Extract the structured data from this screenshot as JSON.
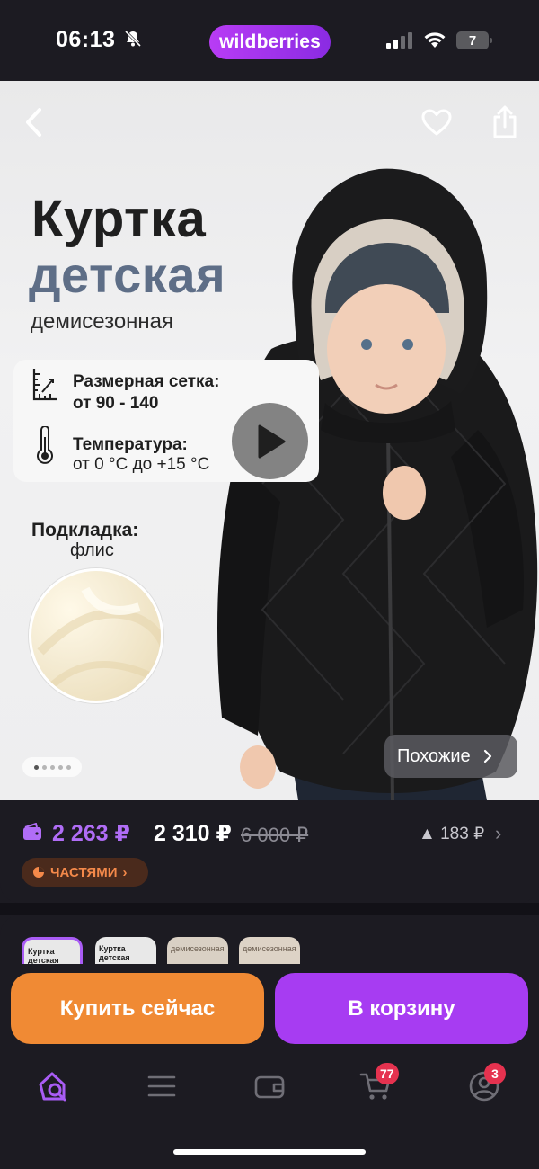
{
  "status_bar": {
    "time": "06:13",
    "brand": "wildberries",
    "battery": "7"
  },
  "hero": {
    "title_line1": "Куртка",
    "title_line2": "детская",
    "subtitle": "демисезонная",
    "size_label": "Размерная сетка:",
    "size_value": "от 90 - 140",
    "temp_label": "Температура:",
    "temp_value": "от 0 °C до +15 °C",
    "lining_label": "Подкладка:",
    "lining_value": "флис",
    "similar_label": "Похожие",
    "total_slides": 5,
    "active_slide": 1
  },
  "price": {
    "wallet_price": "2 263 ₽",
    "price": "2 310 ₽",
    "old_price": "6 000 ₽",
    "delta": "▲ 183 ₽",
    "parts_label": "ЧАСТЯМИ"
  },
  "thumbnails": [
    {
      "text": "Куртка детская"
    },
    {
      "text": "Куртка детская"
    },
    {
      "text": "демисезонная"
    },
    {
      "text": "демисезонная"
    }
  ],
  "actions": {
    "buy_now": "Купить сейчас",
    "add_to_cart": "В корзину"
  },
  "tabbar": {
    "cart_badge": "77",
    "profile_badge": "3"
  },
  "colors": {
    "accent_purple": "#a73cf2",
    "accent_orange": "#f08a34",
    "wallet_price": "#b06df6",
    "background": "#1c1b22"
  }
}
